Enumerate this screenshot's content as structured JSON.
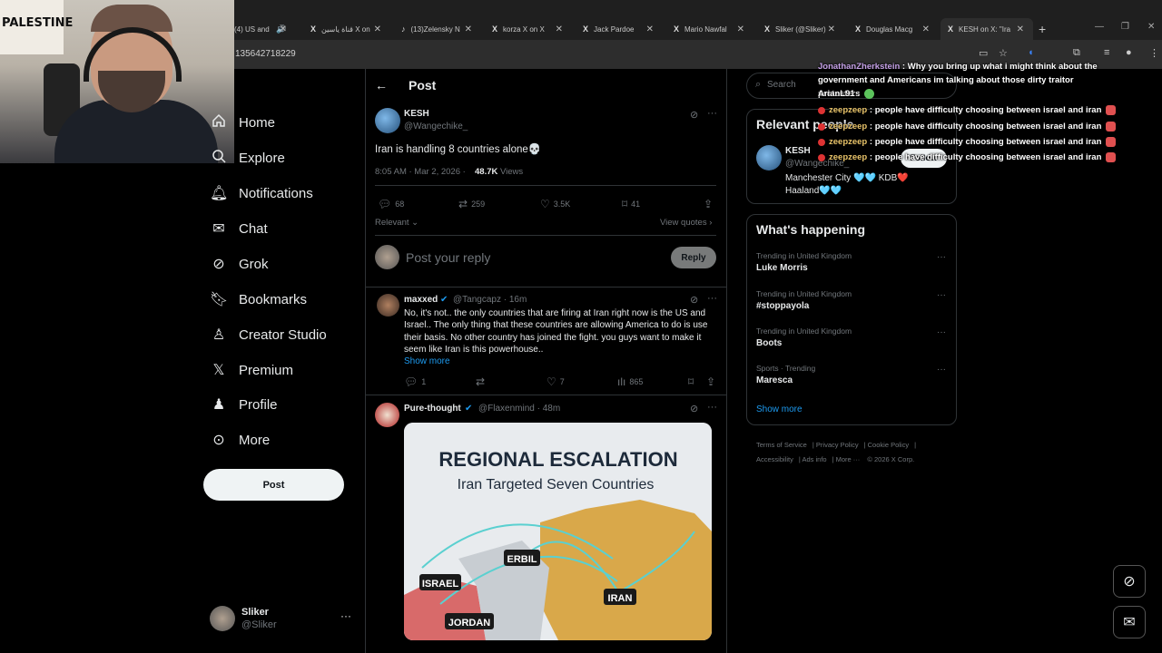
{
  "browser": {
    "tabs": [
      {
        "icon": "speaker-icon",
        "title": "(4) US and"
      },
      {
        "icon": "x-logo-icon",
        "title": "قناة ياسين X on"
      },
      {
        "icon": "tiktok-icon",
        "title": "(13)Zelensky N"
      },
      {
        "icon": "x-logo-icon",
        "title": "korza X on X"
      },
      {
        "icon": "x-logo-icon",
        "title": "Jack Pardoe"
      },
      {
        "icon": "x-logo-icon",
        "title": "Mario Nawfal"
      },
      {
        "icon": "x-logo-icon",
        "title": "Sliker (@Sliker)"
      },
      {
        "icon": "x-logo-icon",
        "title": "Douglas Macg"
      },
      {
        "icon": "x-logo-icon",
        "title": "KESH on X: \"Ira"
      }
    ],
    "url": "135642718229"
  },
  "webcam": {
    "flag_text": "PALESTINE"
  },
  "nav": {
    "items": [
      {
        "icon": "home-icon",
        "label": "Home"
      },
      {
        "icon": "explore-icon",
        "label": "Explore"
      },
      {
        "icon": "bell-icon",
        "label": "Notifications"
      },
      {
        "icon": "mail-icon",
        "label": "Chat"
      },
      {
        "icon": "grok-icon",
        "label": "Grok"
      },
      {
        "icon": "bookmark-icon",
        "label": "Bookmarks"
      },
      {
        "icon": "creator-studio-icon",
        "label": "Creator Studio"
      },
      {
        "icon": "x-logo-icon",
        "label": "Premium"
      },
      {
        "icon": "person-icon",
        "label": "Profile"
      },
      {
        "icon": "more-circle-icon",
        "label": "More"
      }
    ],
    "post_button": "Post",
    "account": {
      "name": "Sliker",
      "handle": "@Sliker"
    }
  },
  "post": {
    "header_title": "Post",
    "author_name": "KESH",
    "author_handle": "@Wangechike_",
    "text": "Iran is handling 8 countries alone💀",
    "time": "8:05 AM · Mar 2, 2026 ·",
    "views": "48.7K",
    "views_label": "Views",
    "stats": {
      "replies": "68",
      "reposts": "259",
      "likes": "3.5K",
      "bookmarks": "41"
    },
    "sort_label": "Relevant",
    "view_quotes": "View quotes",
    "reply_placeholder": "Post your reply",
    "reply_button": "Reply"
  },
  "replies": [
    {
      "name": "maxxed",
      "handle": "@Tangcapz · 16m",
      "text": "No, it's not.. the only countries that are firing at Iran right now is the US and Israel.. The only thing that these countries are allowing America to do is use their basis. No other country has joined the fight. you guys want to make it seem like Iran is this powerhouse..",
      "show_more": "Show more",
      "stats": {
        "replies": "1",
        "reposts": "",
        "likes": "7",
        "views": "865"
      }
    },
    {
      "name": "Pure-thought",
      "handle": "@Flaxenmind · 48m",
      "image": {
        "title": "REGIONAL ESCALATION",
        "subtitle": "Iran Targeted Seven Countries",
        "labels": [
          "ERBIL",
          "ISRAEL",
          "IRAN",
          "JORDAN"
        ]
      }
    }
  ],
  "sidebar": {
    "search_placeholder": "Search",
    "relevant_title": "Relevant people",
    "person": {
      "name": "KESH",
      "handle": "@Wangechike_",
      "bio": "Manchester City 🩵🩵 KDB❤️ Haaland🩵🩵",
      "follow": "Follow"
    },
    "trending_title": "What's happening",
    "trends": [
      {
        "context": "Trending in United Kingdom",
        "name": "Luke Morris"
      },
      {
        "context": "Trending in United Kingdom",
        "name": "#stoppayola"
      },
      {
        "context": "Trending in United Kingdom",
        "name": "Boots"
      },
      {
        "context": "Sports · Trending",
        "name": "Maresca"
      }
    ],
    "show_more": "Show more",
    "footer": [
      "Terms of Service",
      "Privacy Policy",
      "Cookie Policy",
      "Accessibility",
      "Ads info",
      "More ···",
      "© 2026 X Corp."
    ]
  },
  "chat_overlay": [
    {
      "user": "JonathanZherkstein",
      "message": ": Why you bring up what i might think about the government and Americans im talking about those dirty traitor protesters"
    },
    {
      "user": "ArianL91",
      "message": ":"
    },
    {
      "user": "zeepzeep",
      "message": ": people have difficulty choosing between israel and iran"
    },
    {
      "user": "zeepzeep",
      "message": ": people have difficulty choosing between israel and iran"
    },
    {
      "user": "zeepzeep",
      "message": ": people have difficulty choosing between israel and iran"
    },
    {
      "user": "zeepzeep",
      "message": ": people have difficulty choosing between israel and iran"
    }
  ]
}
